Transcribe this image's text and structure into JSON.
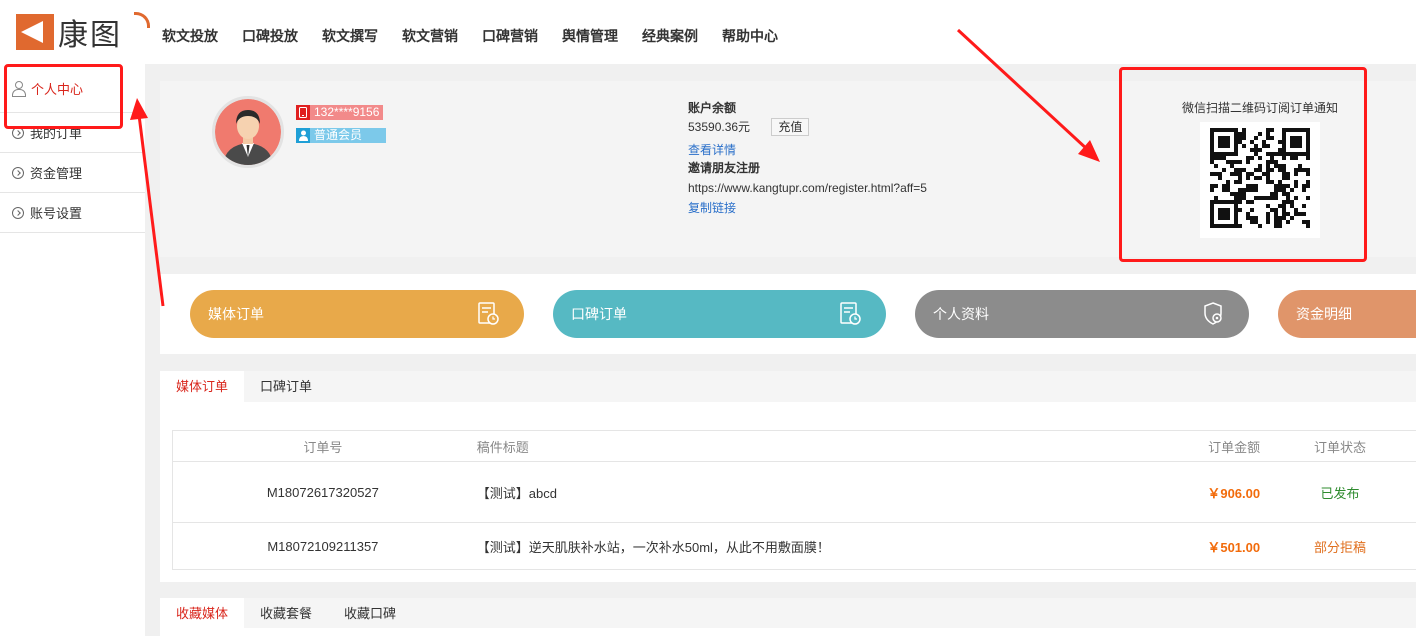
{
  "header": {
    "logo_text": "康图",
    "nav": [
      "软文投放",
      "口碑投放",
      "软文撰写",
      "软文营销",
      "口碑营销",
      "舆情管理",
      "经典案例",
      "帮助中心"
    ]
  },
  "sidebar": {
    "items": [
      {
        "label": "个人中心",
        "icon": "user-icon"
      },
      {
        "label": "我的订单",
        "icon": "chevron-circle-icon"
      },
      {
        "label": "资金管理",
        "icon": "chevron-circle-icon"
      },
      {
        "label": "账号设置",
        "icon": "chevron-circle-icon"
      }
    ]
  },
  "profile": {
    "phone": "132****9156",
    "member_level": "普通会员",
    "balance_label": "账户余额",
    "balance_value": "53590.36元",
    "recharge_label": "充值",
    "view_details": "查看详情",
    "invite_label": "邀请朋友注册",
    "invite_url": "https://www.kangtupr.com/register.html?aff=5",
    "copy_link": "复制链接",
    "qr_caption": "微信扫描二维码订阅订单通知"
  },
  "cards": [
    {
      "label": "媒体订单",
      "color": "#e8a94a"
    },
    {
      "label": "口碑订单",
      "color": "#56b9c3"
    },
    {
      "label": "个人资料",
      "color": "#8c8c8c"
    },
    {
      "label": "资金明细",
      "color": "#e0956a"
    }
  ],
  "orders": {
    "tabs": [
      "媒体订单",
      "口碑订单"
    ],
    "columns": [
      "订单号",
      "稿件标题",
      "订单金额",
      "订单状态"
    ],
    "rows": [
      {
        "id": "M18072617320527",
        "title": "【测试】abcd",
        "amount": "￥906.00",
        "status": "已发布",
        "status_color": "#2e8b2e"
      },
      {
        "id": "M18072109211357",
        "title": "【测试】逆天肌肤补水站，一次补水50ml，从此不用敷面膜！",
        "amount": "￥501.00",
        "status": "部分拒稿",
        "status_color": "#e07020"
      }
    ]
  },
  "favorites": {
    "tabs": [
      "收藏媒体",
      "收藏套餐",
      "收藏口碑"
    ]
  },
  "colors": {
    "accent_red": "#d9261c",
    "annotation_red": "#ff1a1a",
    "link_blue": "#2a6fc9",
    "amount_orange": "#f26b0b"
  }
}
